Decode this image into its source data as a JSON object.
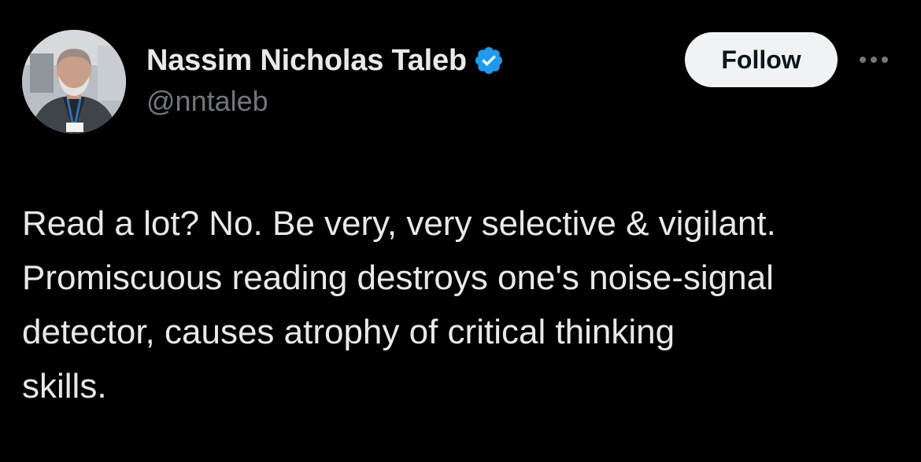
{
  "author": {
    "display_name": "Nassim Nicholas Taleb",
    "handle": "@nntaleb",
    "verified_color": "#1d9bf0",
    "avatar_icon": "profile-photo"
  },
  "actions": {
    "follow_label": "Follow",
    "more_icon": "more-horizontal-icon"
  },
  "tweet": {
    "text": "Read a lot? No. Be very, very selective & vigilant.\nPromiscuous reading destroys one's noise-signal\ndetector, causes atrophy of critical thinking\nskills."
  },
  "colors": {
    "background": "#000000",
    "primary_text": "#e7e9ea",
    "secondary_text": "#71767b",
    "button_bg": "#eff3f4",
    "button_text": "#0f1419"
  }
}
